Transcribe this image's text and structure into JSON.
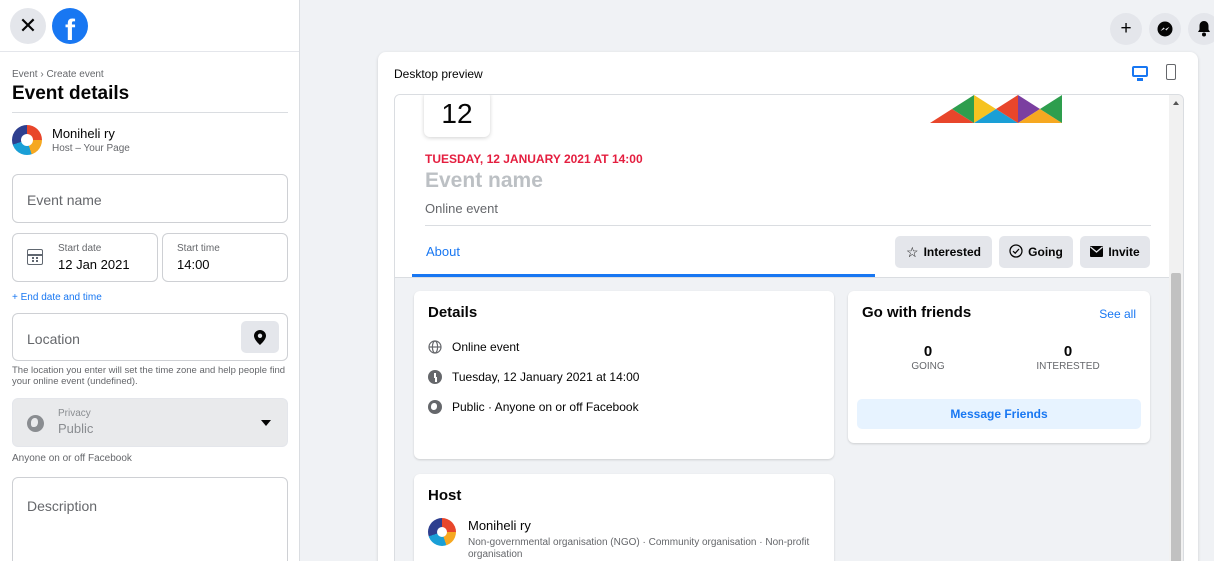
{
  "left_panel": {
    "breadcrumb": "Event › Create event",
    "title": "Event details",
    "host": {
      "name": "Moniheli ry",
      "role": "Host – Your Page"
    },
    "event_name": {
      "placeholder": "Event name"
    },
    "start_date": {
      "label": "Start date",
      "value": "12 Jan 2021"
    },
    "start_time": {
      "label": "Start time",
      "value": "14:00"
    },
    "end_date_link": "+ End date and time",
    "location": {
      "placeholder": "Location",
      "hint": "The location you enter will set the time zone and help people find your online event (undefined)."
    },
    "privacy": {
      "label": "Privacy",
      "value": "Public",
      "hint": "Anyone on or off Facebook"
    },
    "description": {
      "placeholder": "Description"
    }
  },
  "preview": {
    "title": "Desktop preview",
    "date_day": "12",
    "when": "TUESDAY, 12 JANUARY 2021 AT 14:00",
    "event_name": "Event name",
    "event_type": "Online event",
    "tab_about": "About",
    "actions": {
      "interested": "Interested",
      "going": "Going",
      "invite": "Invite"
    },
    "details": {
      "title": "Details",
      "rows": [
        "Online event",
        "Tuesday, 12 January 2021 at 14:00",
        "Public · Anyone on or off Facebook"
      ]
    },
    "friends": {
      "title": "Go with friends",
      "see_all": "See all",
      "going_count": "0",
      "going_label": "GOING",
      "interested_count": "0",
      "interested_label": "INTERESTED",
      "message_button": "Message Friends"
    },
    "host_card": {
      "title": "Host",
      "name": "Moniheli ry",
      "description": "Non-governmental organisation (NGO) · Community organisation · Non-profit organisation"
    }
  },
  "colors": {
    "accent": "#1877f2",
    "date_red": "#e41e3f"
  }
}
